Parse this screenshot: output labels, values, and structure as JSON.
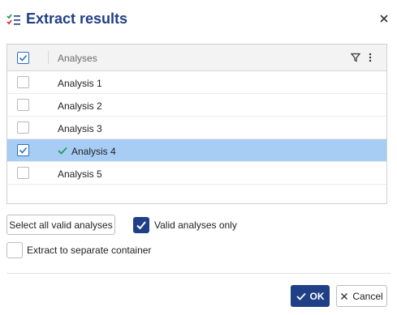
{
  "dialog": {
    "title": "Extract results",
    "close_icon": "close-icon"
  },
  "grid": {
    "header": {
      "select_all_checked": true,
      "column_label": "Analyses",
      "filter_icon": "filter-icon",
      "more_icon": "more-vertical-icon"
    },
    "rows": [
      {
        "label": "Analysis 1",
        "checked": false,
        "selected": false,
        "valid": false
      },
      {
        "label": "Analysis 2",
        "checked": false,
        "selected": false,
        "valid": false
      },
      {
        "label": "Analysis 3",
        "checked": false,
        "selected": false,
        "valid": false
      },
      {
        "label": "Analysis 4",
        "checked": true,
        "selected": true,
        "valid": true
      },
      {
        "label": "Analysis 5",
        "checked": false,
        "selected": false,
        "valid": false
      }
    ]
  },
  "options": {
    "select_all_valid_label": "Select all valid analyses",
    "valid_only": {
      "label": "Valid analyses only",
      "checked": true
    },
    "extract_separate": {
      "label": "Extract to separate container",
      "checked": false
    }
  },
  "footer": {
    "ok_label": "OK",
    "cancel_label": "Cancel"
  },
  "colors": {
    "accent": "#1f3f86",
    "selected_row": "#a7cdf5",
    "valid_check": "#1f9d55",
    "header_bg": "#f3f3f3"
  }
}
